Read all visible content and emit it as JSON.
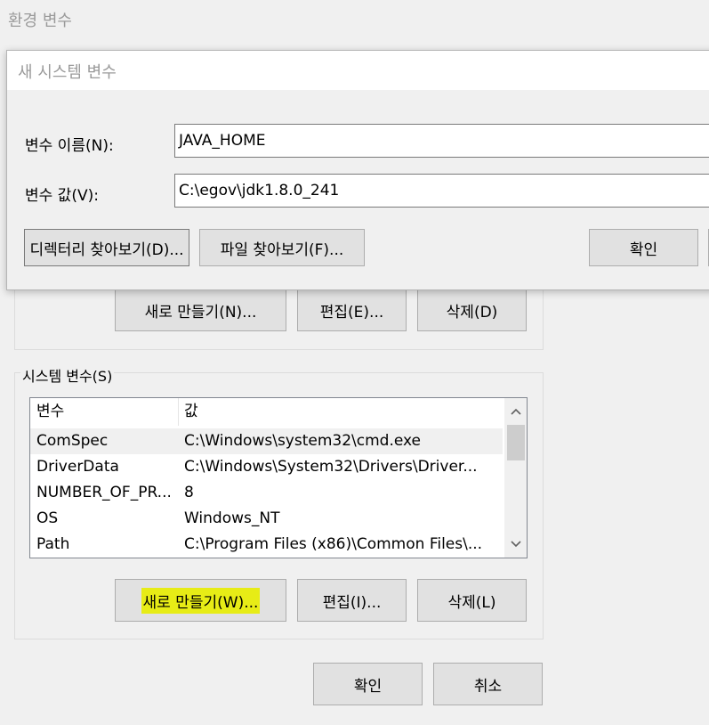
{
  "outer_dialog": {
    "title": "환경 변수",
    "user_vars_buttons": {
      "new": "새로 만들기(N)...",
      "edit": "편집(E)...",
      "delete": "삭제(D)"
    },
    "system_vars": {
      "group_label": "시스템 변수(S)",
      "columns": [
        "변수",
        "값"
      ],
      "rows": [
        {
          "name": "ComSpec",
          "value": "C:\\Windows\\system32\\cmd.exe"
        },
        {
          "name": "DriverData",
          "value": "C:\\Windows\\System32\\Drivers\\Driver..."
        },
        {
          "name": "NUMBER_OF_PR...",
          "value": "8"
        },
        {
          "name": "OS",
          "value": "Windows_NT"
        },
        {
          "name": "Path",
          "value": "C:\\Program Files (x86)\\Common Files\\..."
        }
      ],
      "buttons": {
        "new": "새로 만들기(W)...",
        "edit": "편집(I)...",
        "delete": "삭제(L)"
      }
    },
    "footer": {
      "ok": "확인",
      "cancel": "취소"
    }
  },
  "new_system_var_dialog": {
    "title": "새 시스템 변수",
    "name_label": "변수 이름(N):",
    "name_value": "JAVA_HOME",
    "value_label": "변수 값(V):",
    "value_value": "C:\\egov\\jdk1.8.0_241",
    "browse_dir": "디렉터리 찾아보기(D)...",
    "browse_file": "파일 찾아보기(F)...",
    "ok": "확인"
  },
  "colors": {
    "highlight": "#e7ec16",
    "button_face": "#e1e1e1",
    "window_bg": "#f0f0f0"
  }
}
